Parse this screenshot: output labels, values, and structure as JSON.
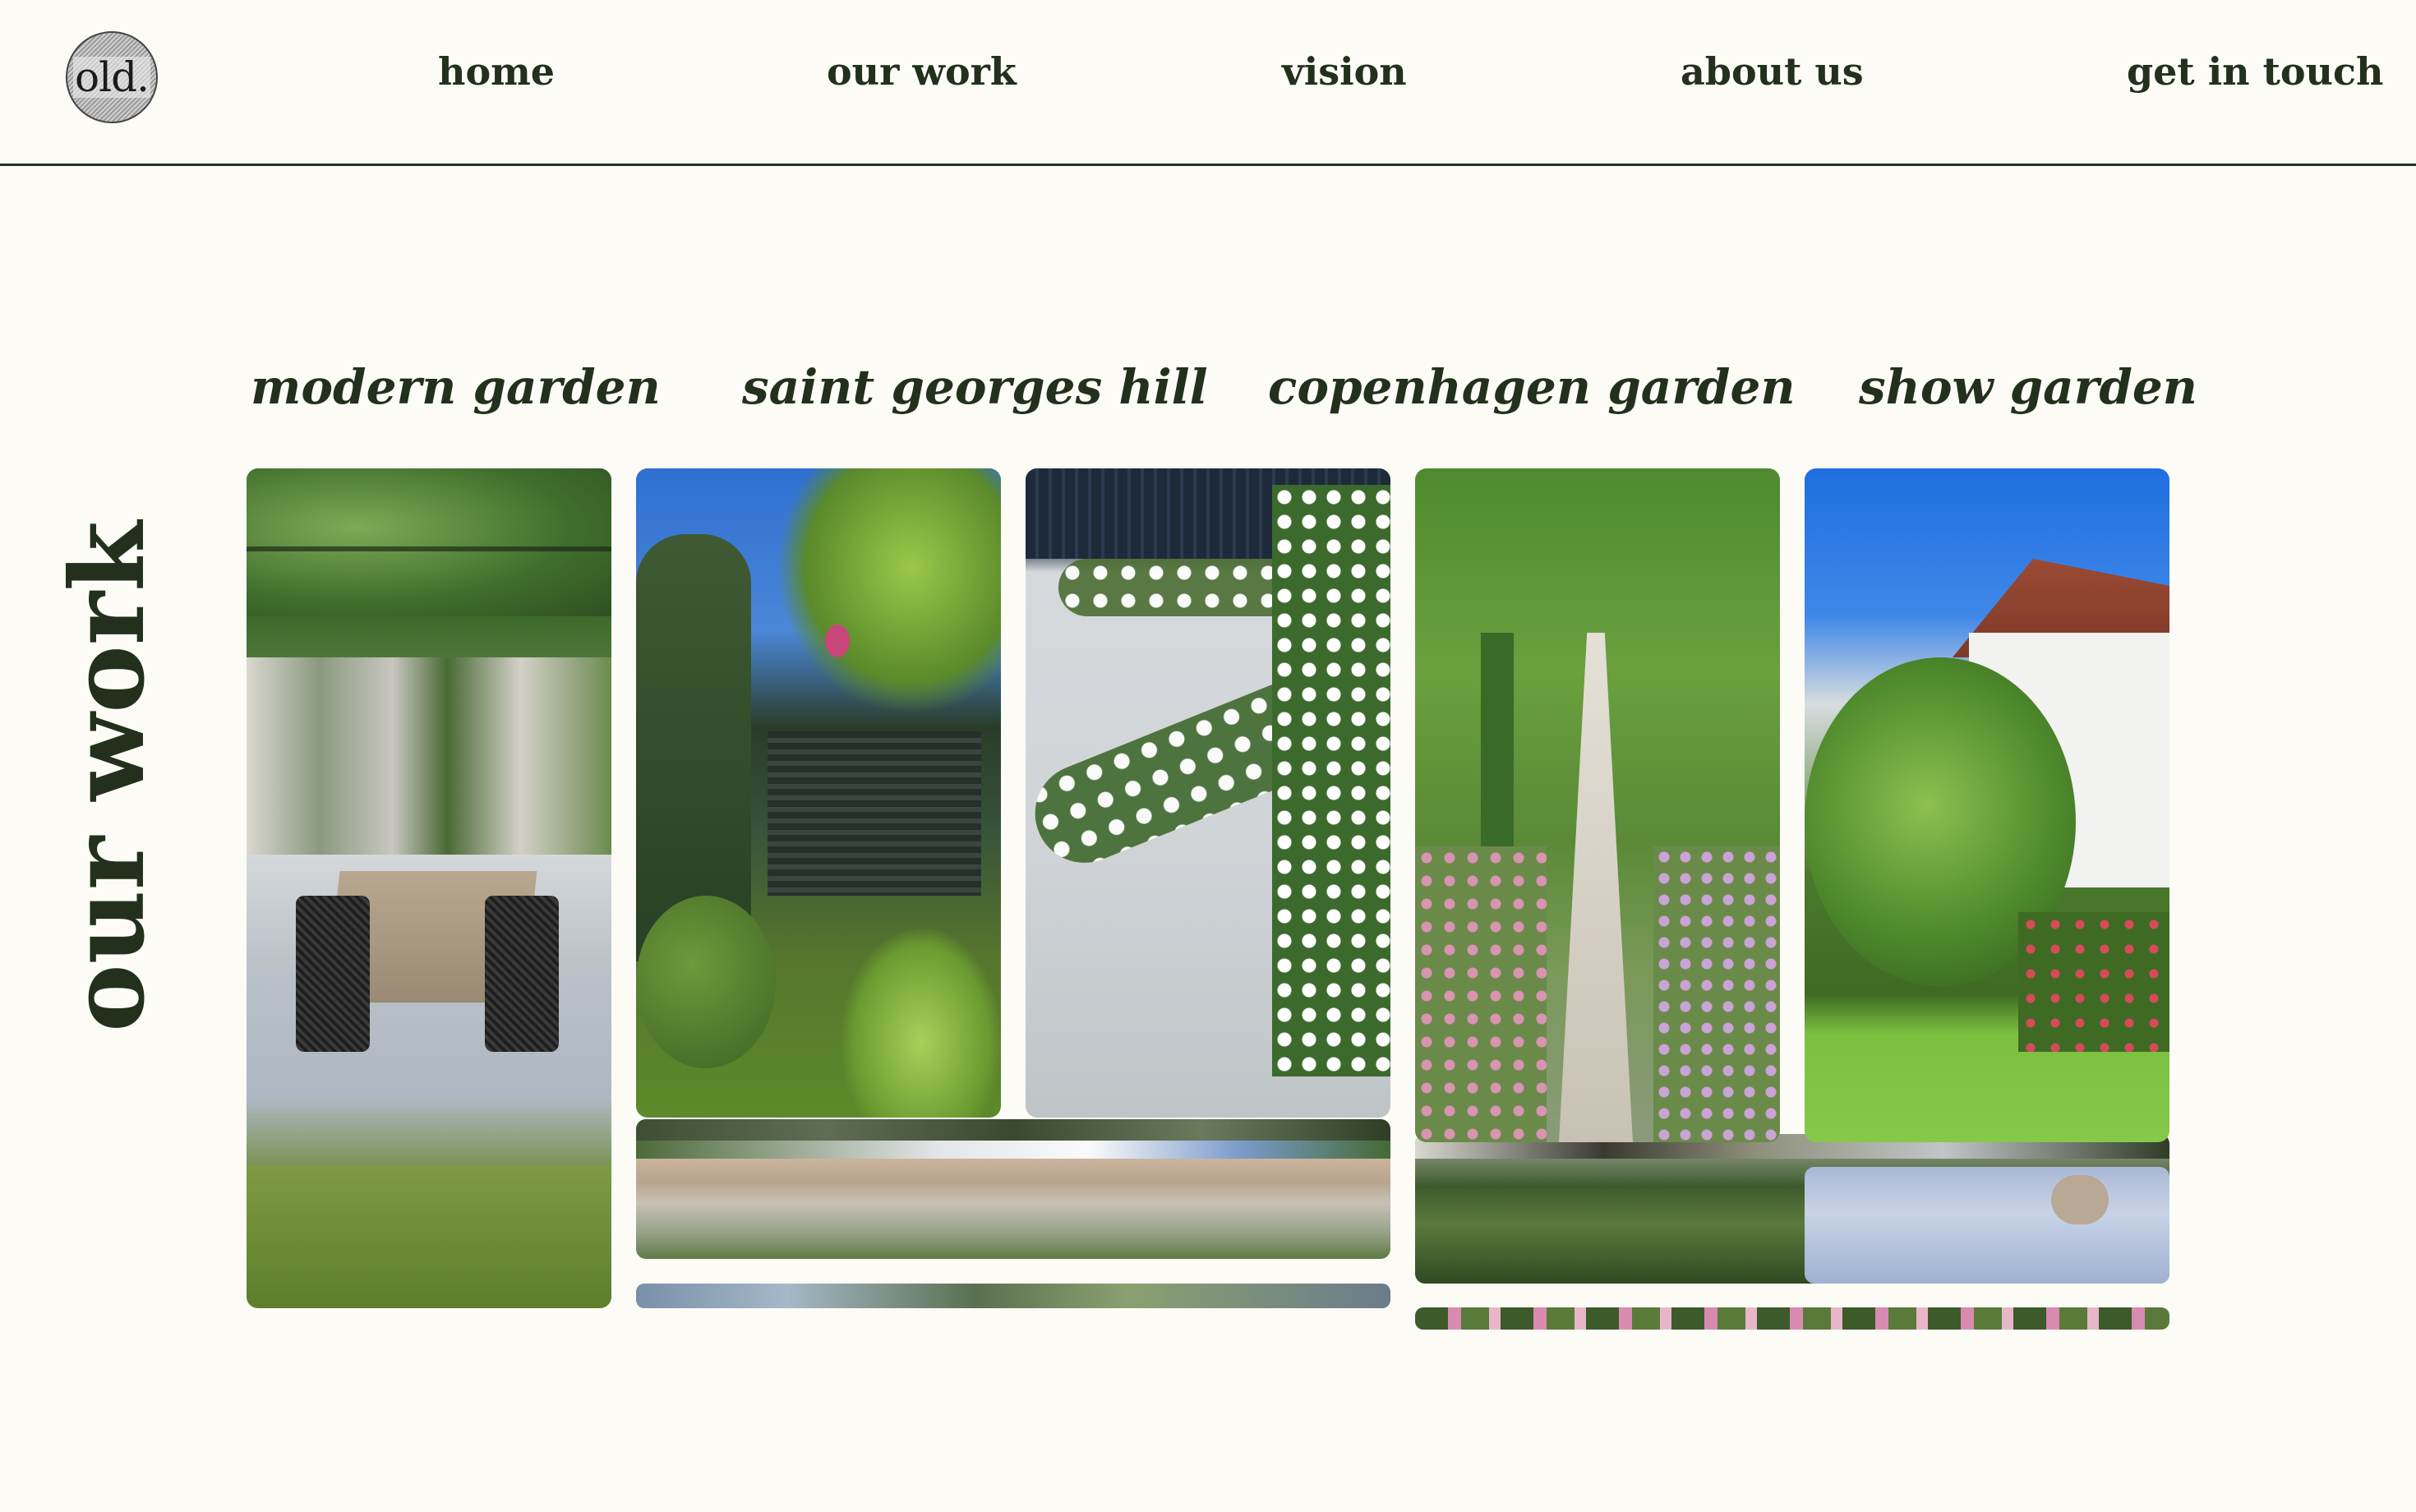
{
  "logo": {
    "text": "old."
  },
  "nav": {
    "home": "home",
    "our_work": "our work",
    "vision": "vision",
    "about_us": "about us",
    "get_in_touch": "get in touch"
  },
  "page_title": "our work",
  "projects": [
    {
      "title": "modern garden"
    },
    {
      "title": "saint georges hill"
    },
    {
      "title": "copenhagen garden"
    },
    {
      "title": "show garden"
    }
  ],
  "colors": {
    "background": "#fdfbf6",
    "text": "#22301c",
    "rule": "#22301c"
  }
}
